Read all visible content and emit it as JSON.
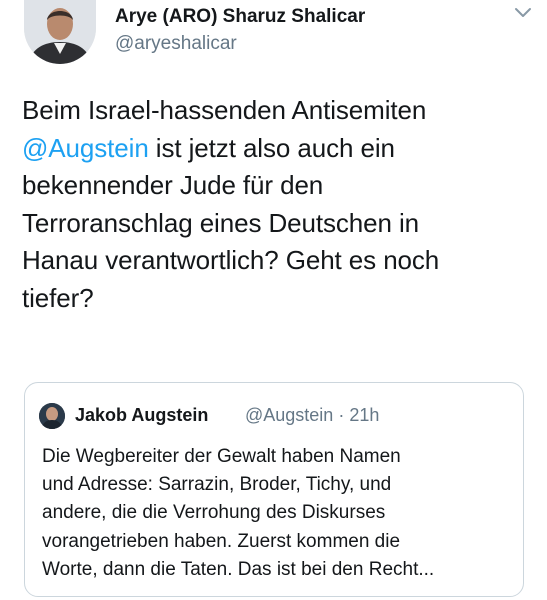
{
  "author": {
    "name": "Arye (ARO) Sharuz Shalicar",
    "handle": "@aryeshalicar"
  },
  "tweet": {
    "line1": "Beim Israel-hassenden Antisemiten",
    "mention": "@Augstein",
    "line2_rest": " ist jetzt also auch ein",
    "line3": "bekennender Jude für den",
    "line4": "Terroranschlag eines Deutschen in",
    "line5": "Hanau verantwortlich? Geht es noch",
    "line6": "tiefer?"
  },
  "quoted_tweet": {
    "name": "Jakob Augstein",
    "meta": "@Augstein · 21h",
    "lines": [
      "Die Wegbereiter der Gewalt haben Namen",
      "und Adresse: Sarrazin, Broder, Tichy, und",
      "andere, die die Verrohung des Diskurses",
      "vorangetrieben haben. Zuerst kommen die",
      "Worte, dann die Taten. Das ist bei den Recht..."
    ]
  },
  "colors": {
    "link": "#1da1f2",
    "secondary_text": "#657786",
    "border": "#ccd6dd"
  },
  "icons": [
    "avatar",
    "chevron-down-icon"
  ]
}
